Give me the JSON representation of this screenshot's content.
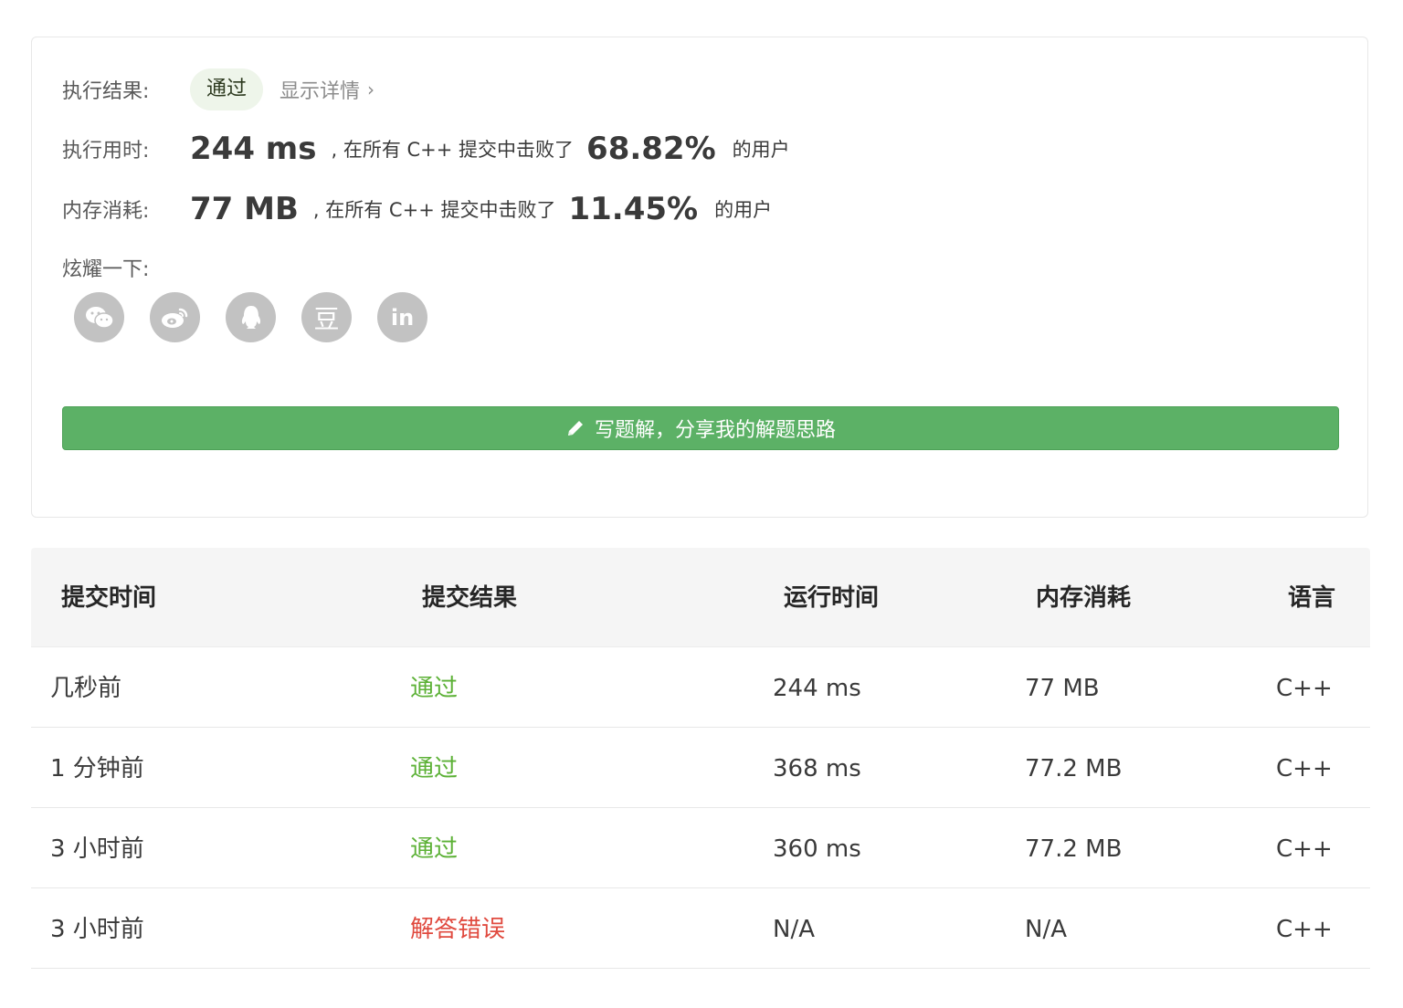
{
  "result": {
    "status_label": "执行结果:",
    "status_value": "通过",
    "details_link": "显示详情",
    "time_label": "执行用时:",
    "time_value": "244 ms",
    "time_beat_text": ", 在所有 C++ 提交中击败了",
    "time_percent": "68.82%",
    "time_tail": "的用户",
    "mem_label": "内存消耗:",
    "mem_value": "77 MB",
    "mem_beat_text": ", 在所有 C++ 提交中击败了",
    "mem_percent": "11.45%",
    "mem_tail": "的用户",
    "share_label": "炫耀一下:",
    "share_icons": [
      "wechat-icon",
      "weibo-icon",
      "qq-icon",
      "douban-icon",
      "linkedin-icon"
    ],
    "douban_glyph": "豆",
    "linkedin_glyph": "in",
    "write_button": "写题解，分享我的解题思路"
  },
  "colors": {
    "accent_green": "#5cb166",
    "pass_green": "#5cb136",
    "fail_red": "#e04a3f"
  },
  "table": {
    "headers": [
      "提交时间",
      "提交结果",
      "运行时间",
      "内存消耗",
      "语言"
    ],
    "rows": [
      {
        "time": "几秒前",
        "result": "通过",
        "runtime": "244 ms",
        "memory": "77 MB",
        "lang": "C++"
      },
      {
        "time": "1 分钟前",
        "result": "通过",
        "runtime": "368 ms",
        "memory": "77.2 MB",
        "lang": "C++"
      },
      {
        "time": "3 小时前",
        "result": "通过",
        "runtime": "360 ms",
        "memory": "77.2 MB",
        "lang": "C++"
      },
      {
        "time": "3 小时前",
        "result": "解答错误",
        "runtime": "N/A",
        "memory": "N/A",
        "lang": "C++"
      }
    ]
  }
}
